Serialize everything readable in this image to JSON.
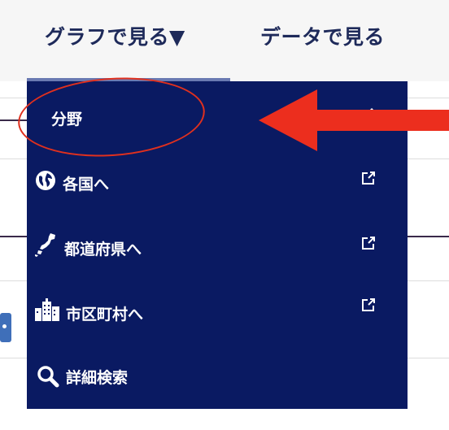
{
  "nav": {
    "tabs": [
      {
        "label": "グラフで見る▼"
      },
      {
        "label": "データで見る"
      }
    ]
  },
  "dropdown": {
    "items": [
      {
        "label": "分野",
        "icon": "chevron-right-icon"
      },
      {
        "label": "各国へ",
        "icon": "globe-icon",
        "trailing": "external-link-icon"
      },
      {
        "label": "都道府県へ",
        "icon": "japan-map-icon",
        "trailing": "external-link-icon"
      },
      {
        "label": "市区町村へ",
        "icon": "city-buildings-icon",
        "trailing": "external-link-icon"
      },
      {
        "label": "詳細検索",
        "icon": "search-icon"
      }
    ]
  },
  "colors": {
    "dropdown_bg": "#0a1a62",
    "nav_text": "#1e2a5a",
    "annotation": "#e0301e",
    "nav_bg": "#f6f6f6"
  }
}
